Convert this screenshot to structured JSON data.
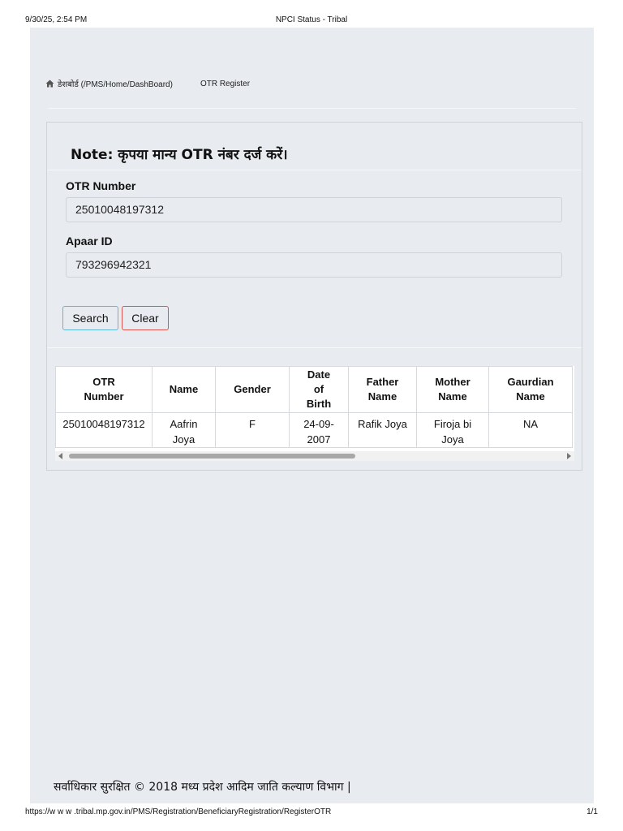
{
  "print_header": {
    "datetime": "9/30/25, 2:54 PM",
    "title": "NPCI Status - Tribal"
  },
  "breadcrumb": {
    "home_icon": "home-icon",
    "dashboard_label": "डेशबोर्ड (/PMS/Home/DashBoard)",
    "current_label": "OTR Register"
  },
  "note": "Note: कृपया मान्य OTR नंबर दर्ज करें।",
  "form": {
    "otr_label": "OTR Number",
    "otr_value": "25010048197312",
    "apaar_label": "Apaar ID",
    "apaar_value": "793296942321",
    "search_label": "Search",
    "clear_label": "Clear"
  },
  "table": {
    "headers": [
      [
        "OTR",
        "Number"
      ],
      [
        "Name"
      ],
      [
        "Gender"
      ],
      [
        "Date",
        "of",
        "Birth"
      ],
      [
        "Father",
        "Name"
      ],
      [
        "Mother",
        "Name"
      ],
      [
        "Gaurdian",
        "Name"
      ]
    ],
    "rows": [
      {
        "otr": "25010048197312",
        "name": [
          "Aafrin",
          "Joya"
        ],
        "gender": "F",
        "dob": [
          "24-09-",
          "2007"
        ],
        "father": "Rafik Joya",
        "mother": [
          "Firoja bi",
          "Joya"
        ],
        "guardian": "NA"
      }
    ]
  },
  "footer": "सर्वाधिकार सुरक्षित © 2018 मध्य प्रदेश आदिम जाति कल्याण विभाग |",
  "print_footer": {
    "url": "https://w w w .tribal.mp.gov.in/PMS/Registration/BeneficiaryRegistration/RegisterOTR",
    "page": "1/1"
  }
}
